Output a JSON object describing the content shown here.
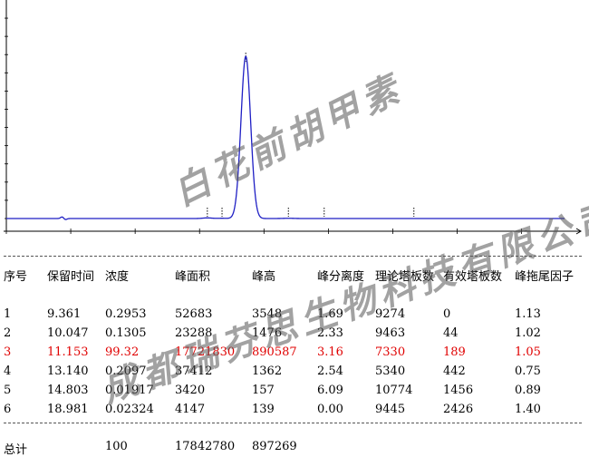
{
  "chart_data": {
    "type": "line",
    "title": "",
    "xlabel": "",
    "ylabel": "",
    "xlim": [
      0,
      26
    ],
    "ylim": [
      0,
      1150000
    ],
    "peaks": [
      {
        "rt": 9.361,
        "height": 3548
      },
      {
        "rt": 10.047,
        "height": 1476
      },
      {
        "rt": 11.153,
        "height": 890587
      },
      {
        "rt": 13.14,
        "height": 1362
      },
      {
        "rt": 14.803,
        "height": 157
      },
      {
        "rt": 18.981,
        "height": 139
      }
    ],
    "line_color": "#1f1fc4"
  },
  "table": {
    "headers": [
      "序号",
      "保留时间",
      "浓度",
      "峰面积",
      "峰高",
      "峰分离度",
      "理论塔板数",
      "有效塔板数",
      "峰拖尾因子"
    ],
    "rows": [
      [
        "1",
        "9.361",
        "0.2953",
        "52683",
        "3548",
        "1.69",
        "9274",
        "0",
        "1.13"
      ],
      [
        "2",
        "10.047",
        "0.1305",
        "23288",
        "1476",
        "2.33",
        "9463",
        "44",
        "1.02"
      ],
      [
        "3",
        "11.153",
        "99.32",
        "17721830",
        "890587",
        "3.16",
        "7330",
        "189",
        "1.05"
      ],
      [
        "4",
        "13.140",
        "0.2097",
        "37412",
        "1362",
        "2.54",
        "5340",
        "442",
        "0.75"
      ],
      [
        "5",
        "14.803",
        "0.01917",
        "3420",
        "157",
        "6.09",
        "10774",
        "1456",
        "0.89"
      ],
      [
        "6",
        "18.981",
        "0.02324",
        "4147",
        "139",
        "0.00",
        "9445",
        "2426",
        "1.40"
      ]
    ],
    "highlight_row": 2,
    "highlight_color": "#e00000",
    "total": {
      "label": "总计",
      "concentration": "100",
      "area": "17842780",
      "height": "897269"
    }
  },
  "watermarks": {
    "line1": "白花前胡甲素",
    "line2": "成都瑞芬思生物科技有限公司"
  }
}
